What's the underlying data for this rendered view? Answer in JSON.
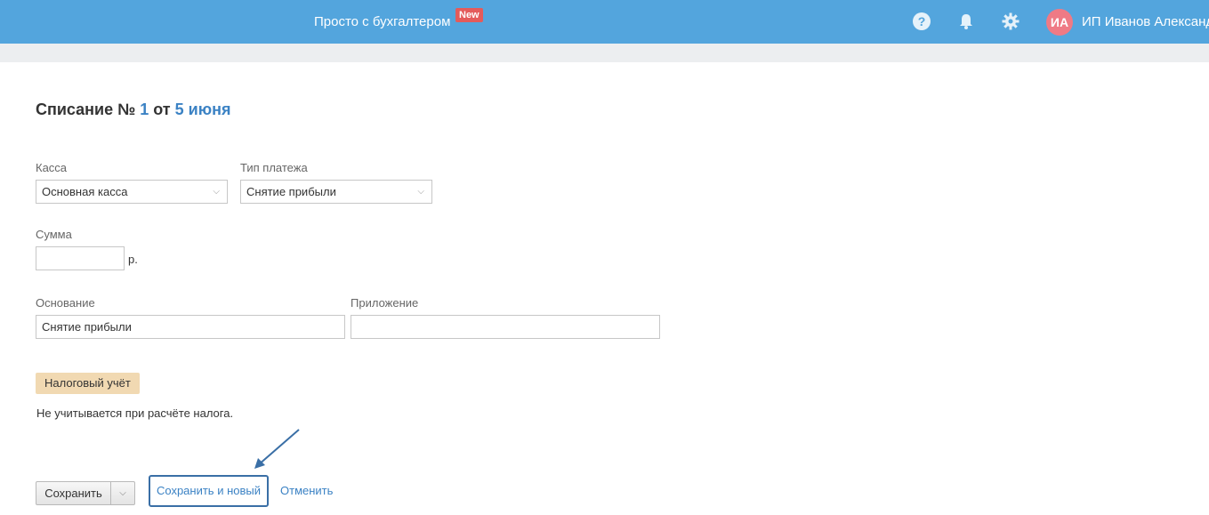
{
  "header": {
    "brand_link": "Просто с бухгалтером",
    "new_badge": "New",
    "user_initials": "ИА",
    "user_name": "ИП Иванов Александр",
    "icons": [
      "help-icon",
      "bell-icon",
      "gear-icon"
    ],
    "bar_color": "#53a5dd"
  },
  "document": {
    "title_prefix": "Списание №",
    "number": "1",
    "title_mid": "от",
    "date": "5 июня"
  },
  "form": {
    "kassa": {
      "label": "Касса",
      "value": "Основная касса"
    },
    "payment_type": {
      "label": "Тип платежа",
      "value": "Снятие прибыли"
    },
    "amount": {
      "label": "Сумма",
      "value": "",
      "suffix": "р."
    },
    "basis": {
      "label": "Основание",
      "value": "Снятие прибыли"
    },
    "attachment": {
      "label": "Приложение",
      "value": ""
    }
  },
  "tax": {
    "badge": "Налоговый учёт",
    "note": "Не учитывается при расчёте налога."
  },
  "actions": {
    "save": "Сохранить",
    "save_new": "Сохранить и новый",
    "cancel": "Отменить"
  }
}
